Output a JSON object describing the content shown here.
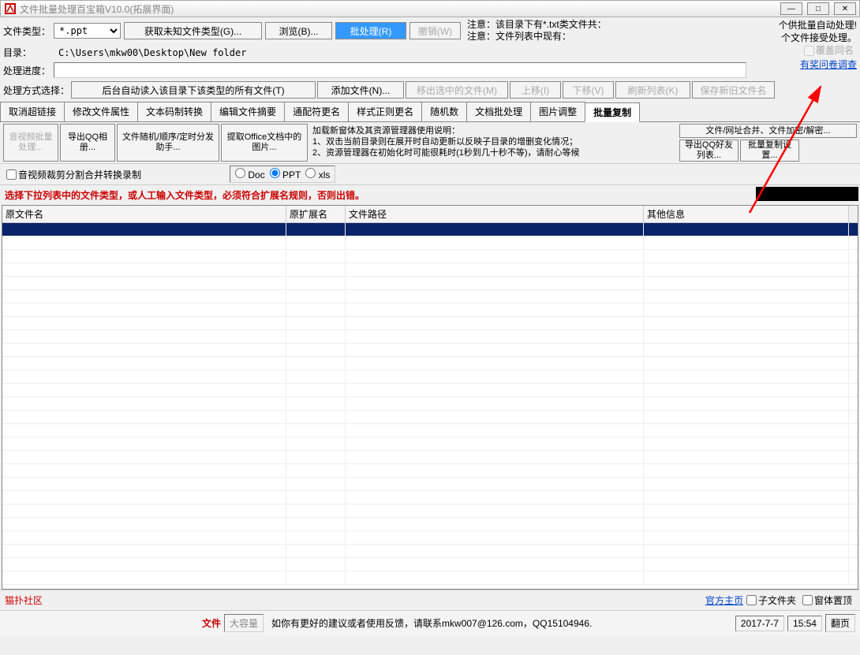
{
  "window": {
    "title": "文件批量处理百宝箱V10.0(拓展界面)"
  },
  "toolbar1": {
    "filetype_label": "文件类型：",
    "filetype_value": "*.ppt",
    "get_unknown": "获取未知文件类型(G)...",
    "browse": "浏览(B)...",
    "batch": "批处理(R)",
    "undo": "撤销(W)",
    "note1": "注意：该目录下有*.txt类文件共：",
    "note2": "注意：文件列表中现有："
  },
  "toolbar2": {
    "dir_label": "目录：",
    "dir_value": "C:\\Users\\mkw00\\Desktop\\New folder"
  },
  "toolbar3": {
    "progress_label": "处理进度："
  },
  "rightinfo": {
    "line1": "个供批量自动处理!",
    "line2": "个文件接受处理。",
    "overwrite": "覆盖同名",
    "survey": "有奖问卷调查"
  },
  "toolbar4": {
    "method_label": "处理方式选择：",
    "auto_read": "后台自动读入该目录下该类型的所有文件(T)",
    "add_file": "添加文件(N)...",
    "remove_sel": "移出选中的文件(M)",
    "move_up": "上移(I)",
    "move_down": "下移(V)",
    "refresh": "刷新列表(K)",
    "save_names": "保存新旧文件名"
  },
  "tabs": {
    "items": [
      "取消超链接",
      "修改文件属性",
      "文本码制转换",
      "编辑文件摘要",
      "通配符更名",
      "样式正则更名",
      "随机数",
      "文档批处理",
      "图片调整",
      "批量复制"
    ],
    "active": 9
  },
  "subtools": {
    "av_batch": "音视频批量处理...",
    "export_qq": "导出QQ相册...",
    "random_order": "文件随机/顺序/定时分发助手...",
    "extract_office": "提取Office文档中的图片...",
    "info_title": "加载新窗体及其资源管理器使用说明：",
    "info1": "1、双击当前目录则在展开时自动更新以反映子目录的增删变化情况；",
    "info2": "2、资源管理器在初始化时可能很耗时(1秒到几十秒不等)，请耐心等候",
    "file_url": "文件/网址合并、文件加密/解密...",
    "export_friends": "导出QQ好友列表...",
    "batch_copy_set": "批量复制设置...",
    "av_crop": "音视频裁剪分割合并转换录制",
    "radio_doc": "Doc",
    "radio_ppt": "PPT",
    "radio_xls": "xls"
  },
  "warning": "选择下拉列表中的文件类型，或人工输入文件类型，必须符合扩展名规则，否则出错。",
  "table": {
    "headers": [
      "原文件名",
      "原扩展名",
      "文件路径",
      "其他信息"
    ],
    "widths": [
      360,
      75,
      378,
      260
    ]
  },
  "footer": {
    "maopu": "猫扑社区",
    "official": "官方主页",
    "subfolder": "子文件夹",
    "topmost": "窗体置顶",
    "file": "文件",
    "capacity": "大容量",
    "feedback": "如你有更好的建议或者使用反馈，请联系mkw007@126.com，QQ15104946.",
    "date": "2017-7-7",
    "time": "15:54",
    "flip": "翻页"
  }
}
